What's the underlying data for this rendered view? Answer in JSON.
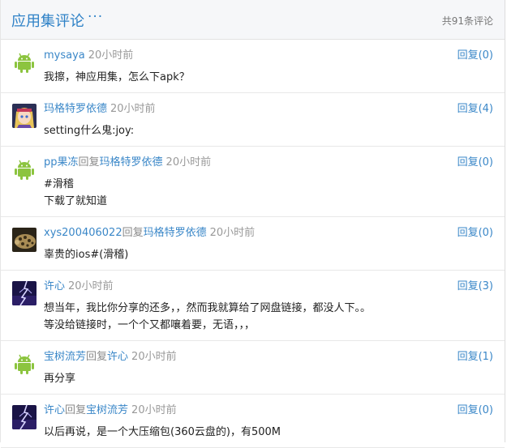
{
  "header": {
    "title": "应用集评论",
    "more": "···",
    "count": "共91条评论"
  },
  "comments": [
    {
      "user": "mysaya",
      "reply_word": "",
      "reply_to": "",
      "time": "20小时前",
      "reply_label": "回复(0)",
      "avatar": "android-icon",
      "lines": [
        "我擦，神应用集，怎么下apk？"
      ]
    },
    {
      "user": "玛格特罗依德",
      "reply_word": "",
      "reply_to": "",
      "time": "20小时前",
      "reply_label": "回复(4)",
      "avatar": "anime-avatar",
      "lines": [
        "setting什么鬼:joy:"
      ]
    },
    {
      "user": "pp果冻",
      "reply_word": "回复",
      "reply_to": "玛格特罗依德",
      "time": "20小时前",
      "reply_label": "回复(0)",
      "avatar": "android-icon",
      "lines": [
        "#滑稽",
        "下载了就知道"
      ]
    },
    {
      "user": "xys200406022",
      "reply_word": "回复",
      "reply_to": "玛格特罗依德",
      "time": "20小时前",
      "reply_label": "回复(0)",
      "avatar": "animal-photo-avatar",
      "lines": [
        "辜贵的ios#(滑稽)"
      ]
    },
    {
      "user": "许心",
      "reply_word": "",
      "reply_to": "",
      "time": "20小时前",
      "reply_label": "回复(3)",
      "avatar": "lightning-avatar",
      "lines": [
        "想当年，我比你分享的还多，，然而我就算给了网盘链接，都没人下。。",
        "等没给链接时，一个个又都嚷着要，无语，，，"
      ]
    },
    {
      "user": "宝树流芳",
      "reply_word": "回复",
      "reply_to": "许心",
      "time": "20小时前",
      "reply_label": "回复(1)",
      "avatar": "android-icon",
      "lines": [
        "再分享"
      ]
    },
    {
      "user": "许心",
      "reply_word": "回复",
      "reply_to": "宝树流芳",
      "time": "20小时前",
      "reply_label": "回复(0)",
      "avatar": "lightning-avatar",
      "lines": [
        "以后再说，是一个大压缩包(360云盘的)，有500M"
      ]
    }
  ]
}
